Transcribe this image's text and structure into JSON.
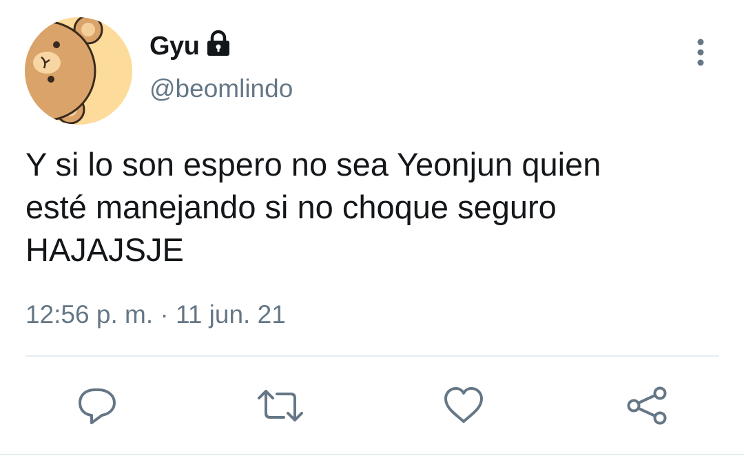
{
  "user": {
    "display_name": "Gyu",
    "handle": "@beomlindo",
    "avatar_icon": "bear-avatar-icon",
    "protected_icon": "lock-icon"
  },
  "tweet": {
    "text": "Y si lo son espero no sea Yeonjun quien\nesté manejando si no choque seguro\nHAJAJSJE",
    "timestamp": "12:56 p. m. · 11 jun. 21"
  },
  "actions": [
    {
      "name": "reply",
      "icon": "comment-icon"
    },
    {
      "name": "retweet",
      "icon": "retweet-icon"
    },
    {
      "name": "like",
      "icon": "heart-icon"
    },
    {
      "name": "share",
      "icon": "share-icon"
    }
  ],
  "colors": {
    "text": "#14171a",
    "secondary_text": "#657786",
    "divider": "#e6ecf0",
    "icon": "#657786",
    "avatar_bg": "#fddb9a",
    "bear_fur": "#d9a36a"
  }
}
